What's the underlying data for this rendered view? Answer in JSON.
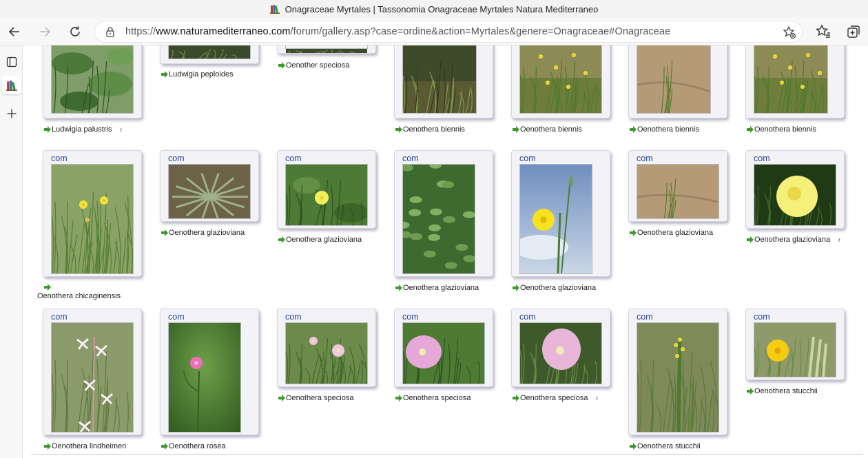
{
  "window": {
    "title": "Onagraceae Myrtales | Tassonomia Onagraceae Myrtales Natura Mediterraneo"
  },
  "address_bar": {
    "prefix": "https://",
    "host": "www.naturamediterraneo.com",
    "path": "/forum/gallery.asp?case=ordine&action=Myrtales&genere=Onagraceae#Onagraceae"
  },
  "colors": {
    "link": "#27479a",
    "arrow": "#3d9a2c",
    "frame_bg": "#f3f2f7"
  },
  "gallery": {
    "link_label": "com",
    "items": [
      {
        "caption": "Ludwigia palustris",
        "tail": "r"
      },
      {
        "caption": "Ludwigia peploides",
        "tail": ""
      },
      {
        "caption": "Oenother speciosa",
        "tail": ""
      },
      {
        "caption": "Oenothera biennis",
        "tail": ""
      },
      {
        "caption": "Oenothera biennis",
        "tail": ""
      },
      {
        "caption": "Oenothera biennis",
        "tail": ""
      },
      {
        "caption": "Oenothera biennis",
        "tail": ""
      },
      {
        "caption": "Oenothera chicaginensis",
        "tail": ""
      },
      {
        "caption": "Oenothera glazioviana",
        "tail": ""
      },
      {
        "caption": "Oenothera glazioviana",
        "tail": ""
      },
      {
        "caption": "Oenothera glazioviana",
        "tail": ""
      },
      {
        "caption": "Oenothera glazioviana",
        "tail": ""
      },
      {
        "caption": "Oenothera glazioviana",
        "tail": ""
      },
      {
        "caption": "Oenothera glazioviana",
        "tail": "r"
      },
      {
        "caption": "Oenothera lindheimeri",
        "tail": ""
      },
      {
        "caption": "Oenothera rosea",
        "tail": ""
      },
      {
        "caption": "Oenothera speciosa",
        "tail": ""
      },
      {
        "caption": "Oenothera speciosa",
        "tail": ""
      },
      {
        "caption": "Oenothera speciosa",
        "tail": "r"
      },
      {
        "caption": "Oenothera stucchii",
        "tail": ""
      },
      {
        "caption": "Oenothera stucchii",
        "tail": ""
      }
    ]
  }
}
